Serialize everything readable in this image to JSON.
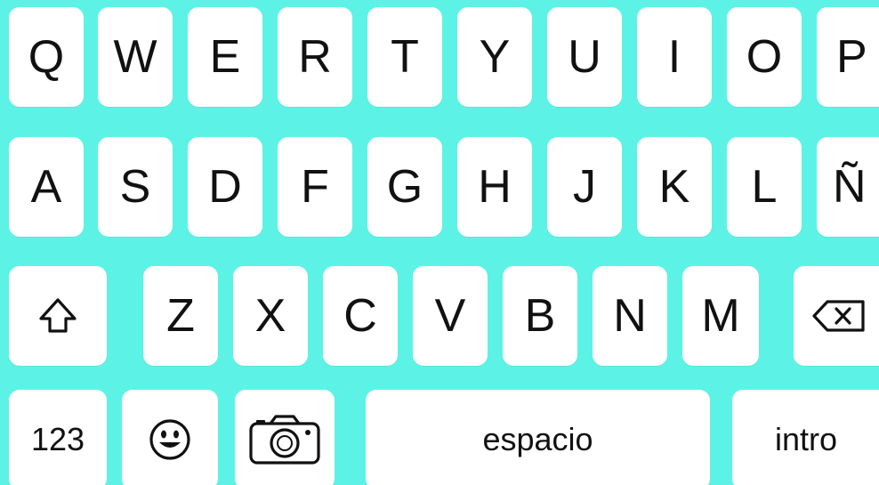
{
  "colors": {
    "background": "#5cf3e6",
    "key": "#ffffff",
    "key_text": "#111111"
  },
  "row1": [
    "Q",
    "W",
    "E",
    "R",
    "T",
    "Y",
    "U",
    "I",
    "O",
    "P"
  ],
  "row2": [
    "A",
    "S",
    "D",
    "F",
    "G",
    "H",
    "J",
    "K",
    "L",
    "Ñ"
  ],
  "row3": [
    "Z",
    "X",
    "C",
    "V",
    "B",
    "N",
    "M"
  ],
  "bottom": {
    "numbers_label": "123",
    "space_label": "espacio",
    "enter_label": "intro"
  },
  "icons": {
    "shift": "shift-icon",
    "delete": "delete-icon",
    "emoji": "emoji-icon",
    "camera": "camera-icon"
  }
}
